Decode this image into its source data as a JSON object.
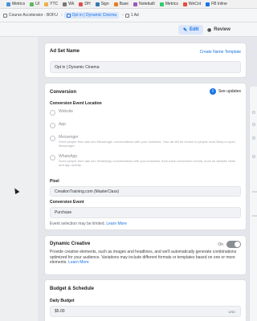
{
  "bookmarks": [
    {
      "label": "Metrics",
      "color": "#4a90d9"
    },
    {
      "label": "UI",
      "color": "#5cb85c"
    },
    {
      "label": "YTC",
      "color": "#f0ad4e"
    },
    {
      "label": "Wk",
      "color": "#777777"
    },
    {
      "label": "DH",
      "color": "#d9534f"
    },
    {
      "label": "Sign",
      "color": "#337ab7"
    },
    {
      "label": "Base",
      "color": "#e67e22"
    },
    {
      "label": "Notebuilt",
      "color": "#9b59b6"
    },
    {
      "label": "Metrics",
      "color": "#2ecc71"
    },
    {
      "label": "WeCnt",
      "color": "#e74c3c"
    },
    {
      "label": "FB Inline",
      "color": "#1b74e4"
    }
  ],
  "breadcrumb": {
    "items": [
      {
        "label": "Course Accelerator - BOFU"
      },
      {
        "label": "Opt in | Dynamic Cinema"
      },
      {
        "label": "1 Ad"
      }
    ]
  },
  "modes": {
    "edit": "Edit",
    "review": "Review"
  },
  "adset_name": {
    "heading": "Ad Set Name",
    "template_link": "Create Name Template",
    "value": "Opt in | Dynamic Cinema"
  },
  "conversion": {
    "heading": "Conversion",
    "see_updates": "See updates",
    "location_label": "Conversion Event Location",
    "options": [
      {
        "title": "Website",
        "desc": ""
      },
      {
        "title": "App",
        "desc": ""
      },
      {
        "title": "Messenger",
        "desc": "Send people from ads into Messenger conversations with your business. Your ad will be shown to people most likely to open Messenger."
      },
      {
        "title": "WhatsApp",
        "desc": "Send people from ads into WhatsApp conversations with your business, then track conversion events, such as website visits and app activity."
      }
    ],
    "pixel_label": "Pixel",
    "pixel_value": "CreationTraining.com (MasterClass)",
    "event_label": "Conversion Event",
    "event_value": "Purchase",
    "limited_note": "Event selection may be limited.",
    "learn_more": "Learn More"
  },
  "dynamic_creative": {
    "heading": "Dynamic Creative",
    "toggle_label": "On",
    "desc": "Provide creative elements, such as images and headlines, and we'll automatically generate combinations optimized for your audience. Variations may include different formats or templates based on one or more elements.",
    "learn_more": "Learn More"
  },
  "budget": {
    "heading": "Budget & Schedule",
    "daily_label": "Daily Budget",
    "daily_value": "$5.00",
    "currency": "USD"
  }
}
